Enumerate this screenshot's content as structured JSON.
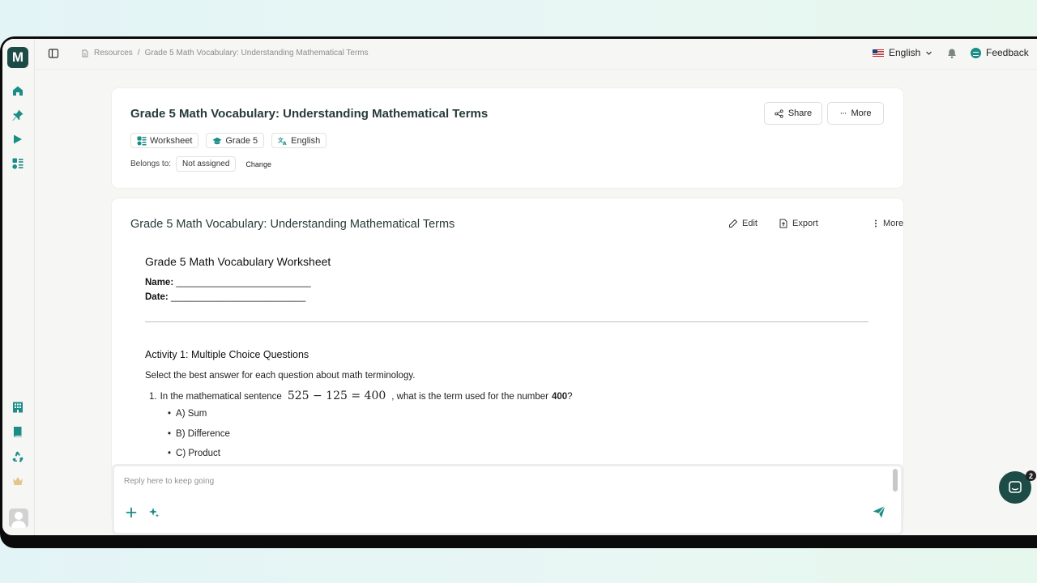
{
  "app": {
    "logo_letter": "M",
    "accent_color": "#1d4b45",
    "icon_color": "#1c8c87"
  },
  "sidebar": {
    "top_icons": [
      "home-icon",
      "pin-icon",
      "play-icon",
      "apps-icon"
    ],
    "bottom_icons": [
      "building-icon",
      "book-icon",
      "recycle-icon",
      "crown-icon"
    ]
  },
  "topbar": {
    "breadcrumb": [
      "Resources",
      "/",
      "Grade 5 Math Vocabulary: Understanding Mathematical Terms"
    ],
    "language": "English",
    "feedback": "Feedback"
  },
  "resource_header": {
    "title": "Grade 5 Math Vocabulary: Understanding Mathematical Terms",
    "share_label": "Share",
    "more_label": "More",
    "chips": [
      "Worksheet",
      "Grade 5",
      "English"
    ],
    "belongs_label": "Belongs to:",
    "belongs_value": "Not assigned",
    "change_label": "Change"
  },
  "content": {
    "title": "Grade 5 Math Vocabulary: Understanding Mathematical Terms",
    "edit_label": "Edit",
    "export_label": "Export",
    "more_label": "More",
    "worksheet": {
      "heading": "Grade 5 Math Vocabulary Worksheet",
      "name_label": "Name:",
      "name_blank": "__________________________",
      "date_label": "Date:",
      "date_blank": "__________________________",
      "activity_heading": "Activity 1: Multiple Choice Questions",
      "instructions": "Select the best answer for each question about math terminology.",
      "question_1": {
        "number": "1.",
        "text_before": "In the mathematical sentence",
        "equation": "525 − 125 = 400",
        "text_after": ", what is the term used for the number",
        "bold_value": "400",
        "end": "?",
        "options": [
          "A) Sum",
          "B) Difference",
          "C) Product"
        ]
      }
    }
  },
  "reply": {
    "placeholder": "Reply here to keep going"
  },
  "chat_widget": {
    "badge_count": "2"
  }
}
